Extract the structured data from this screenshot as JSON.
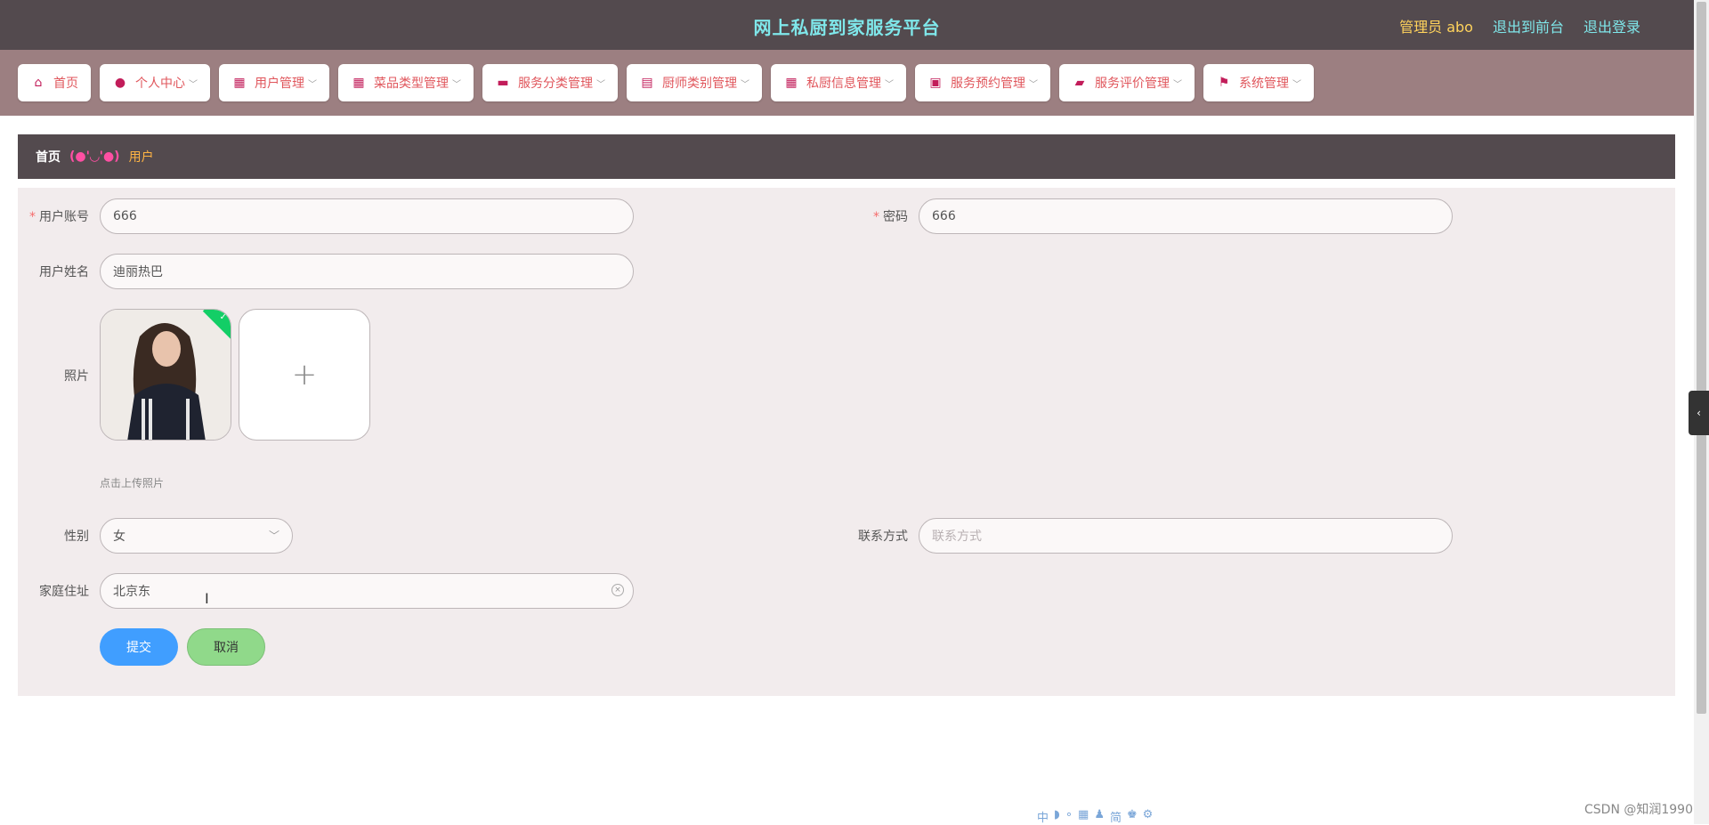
{
  "header": {
    "title": "网上私厨到家服务平台",
    "admin": "管理员 abo",
    "back_to_front": "退出到前台",
    "logout": "退出登录"
  },
  "nav": {
    "items": [
      {
        "label": "首页",
        "icon": "home-icon",
        "glyph": "⌂",
        "has_caret": false
      },
      {
        "label": "个人中心",
        "icon": "user-icon",
        "glyph": "●",
        "has_caret": true
      },
      {
        "label": "用户管理",
        "icon": "grid-icon",
        "glyph": "▦",
        "has_caret": true
      },
      {
        "label": "菜品类型管理",
        "icon": "grid-icon",
        "glyph": "▦",
        "has_caret": true
      },
      {
        "label": "服务分类管理",
        "icon": "monitor-icon",
        "glyph": "▬",
        "has_caret": true
      },
      {
        "label": "厨师类别管理",
        "icon": "clipboard-icon",
        "glyph": "▤",
        "has_caret": true
      },
      {
        "label": "私厨信息管理",
        "icon": "grid-icon",
        "glyph": "▦",
        "has_caret": true
      },
      {
        "label": "服务预约管理",
        "icon": "printer-icon",
        "glyph": "▣",
        "has_caret": true
      },
      {
        "label": "服务评价管理",
        "icon": "comment-icon",
        "glyph": "▰",
        "has_caret": true
      },
      {
        "label": "系统管理",
        "icon": "flag-icon",
        "glyph": "⚑",
        "has_caret": true
      }
    ]
  },
  "breadcrumb": {
    "home": "首页",
    "separator": "(●'◡'●)",
    "current": "用户"
  },
  "form": {
    "account_label": "用户账号",
    "account_value": "666",
    "password_label": "密码",
    "password_value": "666",
    "name_label": "用户姓名",
    "name_value": "迪丽热巴",
    "photo_label": "照片",
    "upload_plus": "+",
    "upload_tip": "点击上传照片",
    "gender_label": "性别",
    "gender_value": "女",
    "contact_label": "联系方式",
    "contact_placeholder": "联系方式",
    "address_label": "家庭住址",
    "address_value": "北京东",
    "submit": "提交",
    "cancel": "取消"
  },
  "misc": {
    "side_toggle": "‹",
    "watermark": "CSDN @知润1990",
    "ime_items": [
      "中",
      "◗",
      "∘",
      "▦",
      "♟",
      "简",
      "♚",
      "⚙"
    ]
  },
  "colors": {
    "header_bg": "#534a4e",
    "title": "#7fe7ea",
    "nav_bg": "#9c7f81",
    "nav_text": "#e0565c",
    "panel_bg": "#f2eced",
    "submit_bg": "#409eff",
    "cancel_bg": "#90d98a"
  }
}
